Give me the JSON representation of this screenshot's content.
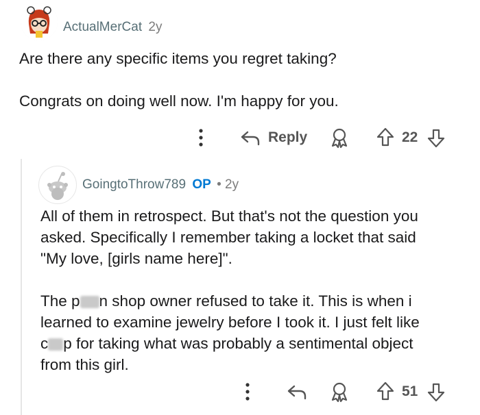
{
  "comment1": {
    "username": "ActualMerCat",
    "age": "2y",
    "paragraphs": [
      "Are there any specific items you regret taking?",
      "Congrats on doing well now. I'm happy for you."
    ],
    "actions": {
      "reply_label": "Reply",
      "vote_count": "22"
    }
  },
  "comment2": {
    "username": "GoingtoThrow789",
    "op_badge": "OP",
    "separator": "•",
    "age": "2y",
    "paragraph1": [
      "All of them in retrospect. But that's not the question you",
      "asked. Specifically I remember taking a locket that said",
      "\"My love, [girls name here]\"."
    ],
    "paragraph2": {
      "line1_a": "The p",
      "line1_b": "n shop owner refused to take it. This is when i",
      "line2": "learned to examine jewelry before I took it. I just felt like",
      "line3_a": "c",
      "line3_b": "p for taking what was probably a sentimental object",
      "line4": "from this girl."
    },
    "actions": {
      "vote_count": "51"
    }
  },
  "icons": [
    "more-icon",
    "reply-icon",
    "award-icon",
    "upvote-icon",
    "downvote-icon",
    "avatar-icon"
  ],
  "colors": {
    "username": "#576f76",
    "op": "#0079d3",
    "text": "#1a1a1b",
    "icon": "#555555"
  }
}
